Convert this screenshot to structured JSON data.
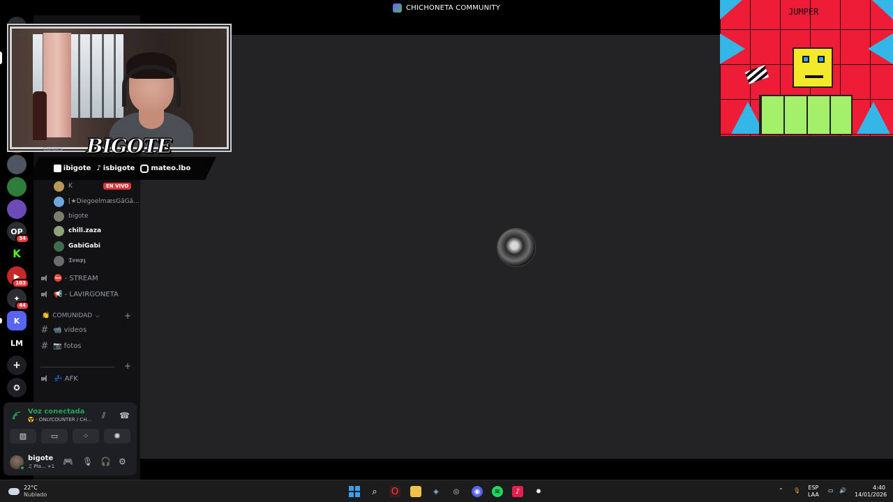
{
  "window": {
    "title": "CHICHONETA COMMUNITY"
  },
  "server": {
    "name": "CHICHONETA CO..."
  },
  "rail": {
    "badges": [
      "34",
      "103",
      "44"
    ],
    "lm_label": "LM",
    "k_label": "K"
  },
  "sidebar": {
    "canales_label": "Canales",
    "voice_users": [
      {
        "name": "K",
        "live": "EN VIVO",
        "color": "#b59b57"
      },
      {
        "name": "[★DiegoelmæsGãGã...",
        "color": "#6fa8dc"
      },
      {
        "name": "bigote",
        "color": "#7a7f6b"
      },
      {
        "name": "chill.zaza",
        "color": "#8da37b"
      },
      {
        "name": "GabiGabi",
        "color": "#3f6b4f"
      },
      {
        "name": "𝕿𝖔𝖒𝖕𝖟",
        "color": "#6b6b6b"
      }
    ],
    "voice_channels": [
      "⛔ - STREAM",
      "📢 - LAVIRGONETA"
    ],
    "category": "COMUNIDAD",
    "text_channels": [
      "📹 videos",
      "📷 fotos"
    ],
    "afk": "💤 AFK"
  },
  "voice_panel": {
    "title": "Voz conectada",
    "subtitle": "☢️ - ONLYCOUNTER / CH...",
    "user": {
      "name": "bigote",
      "status": "♫ Pla... +1"
    }
  },
  "overlay": {
    "logo_text": "BIGOTE",
    "socials": [
      {
        "platform": "kick",
        "handle": "ibigote"
      },
      {
        "platform": "tiktok",
        "handle": "isbigote"
      },
      {
        "platform": "instagram",
        "handle": "mateo.lbo"
      }
    ]
  },
  "game": {
    "title": "JUMPER"
  },
  "taskbar": {
    "weather": {
      "temp": "22°C",
      "condition": "Nublado"
    },
    "lang": {
      "line1": "ESP",
      "line2": "LAA"
    },
    "clock": {
      "time": "4:40",
      "date": "14/01/2026"
    }
  }
}
